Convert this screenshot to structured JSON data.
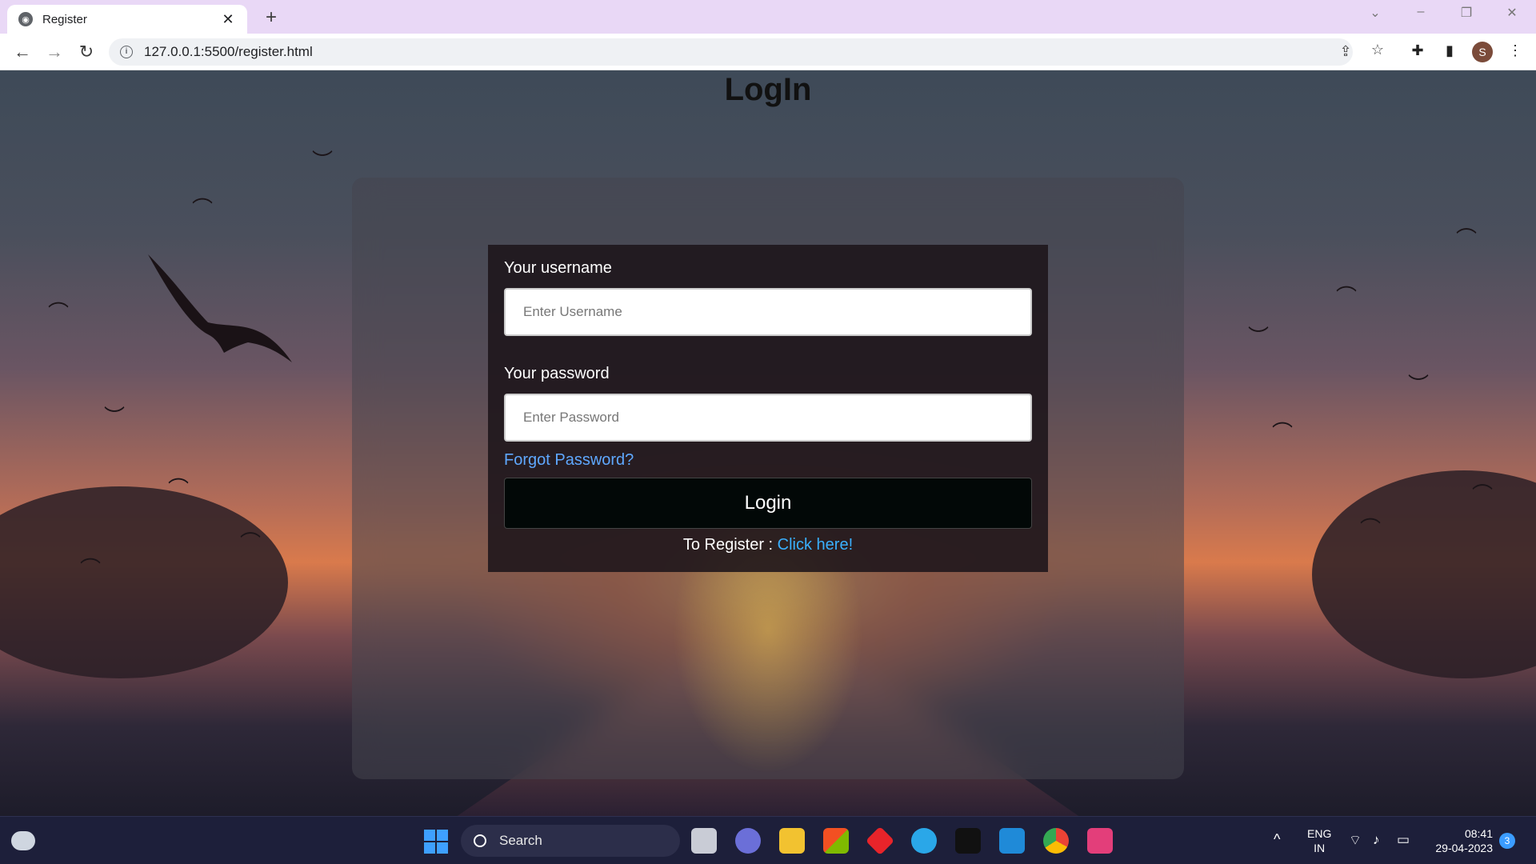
{
  "browser": {
    "tab_title": "Register",
    "new_tab_label": "+",
    "url": "127.0.0.1:5500/register.html",
    "profile_initial": "S",
    "icons": [
      "globe-icon",
      "close-icon",
      "back-icon",
      "forward-icon",
      "reload-icon",
      "info-icon",
      "share-icon",
      "star-icon",
      "extensions-icon",
      "sidepanel-icon",
      "menu-icon"
    ]
  },
  "page": {
    "title": "LogIn",
    "username_label": "Your username",
    "username_placeholder": "Enter Username",
    "password_label": "Your password",
    "password_placeholder": "Enter Password",
    "forgot_link": "Forgot Password?",
    "login_button": "Login",
    "register_prefix": "To Register : ",
    "register_link": "Click here!"
  },
  "taskbar": {
    "search_label": "Search",
    "lang_line1": "ENG",
    "lang_line2": "IN",
    "time": "08:41",
    "date": "29-04-2023",
    "notification_count": "3",
    "apps": [
      "task-view-icon",
      "teams-icon",
      "file-explorer-icon",
      "store-icon",
      "diamond-app-icon",
      "help-icon",
      "arc-icon",
      "vscode-icon",
      "chrome-icon",
      "snipping-tool-icon"
    ]
  },
  "colors": {
    "tabbar": "#e9d8f6",
    "link": "#5fa8ff",
    "register_link": "#3ab0ff",
    "button_bg": "#020807",
    "taskbar": "#1d1f3a"
  }
}
